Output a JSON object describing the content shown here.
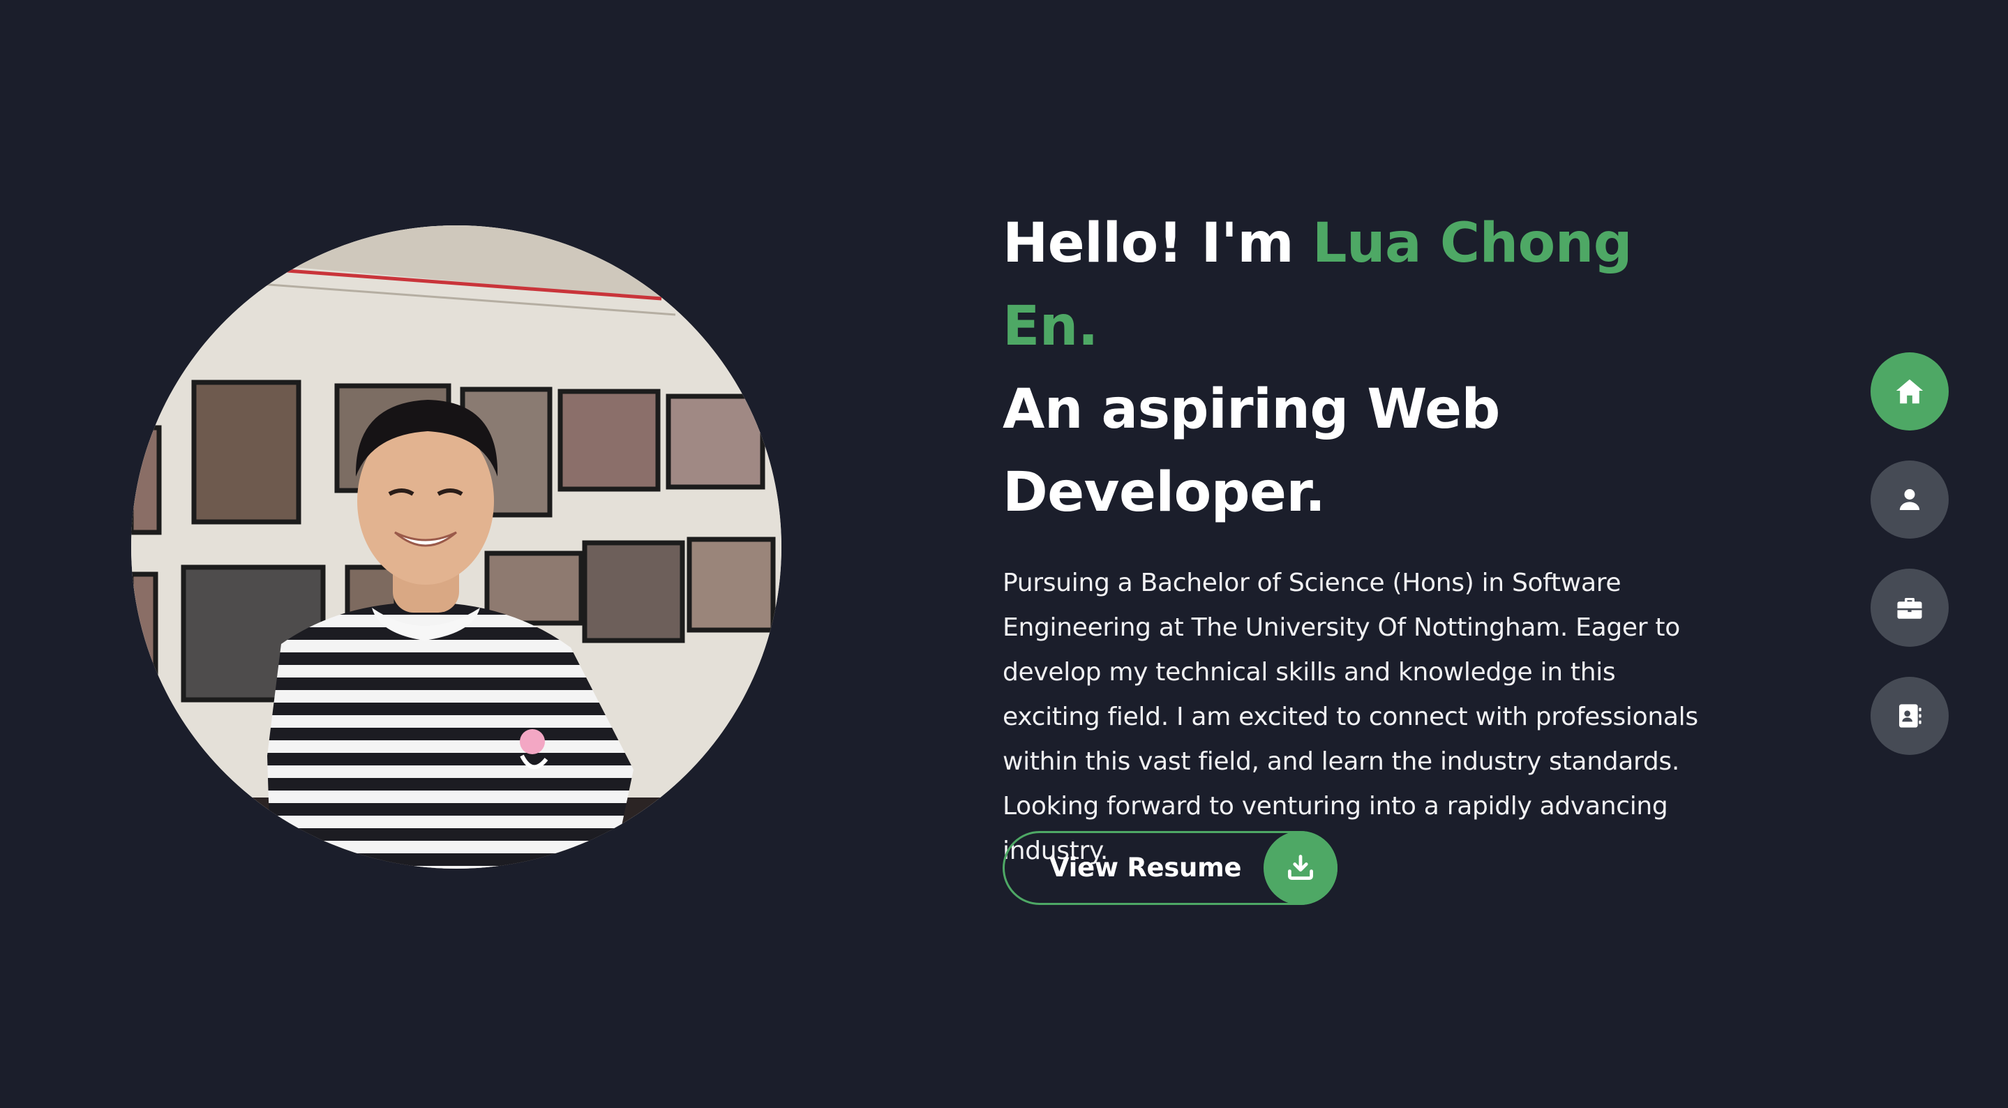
{
  "colors": {
    "background": "#1b1e2b",
    "accent": "#4ea865",
    "nav_inactive": "#464b55",
    "text": "#ffffff"
  },
  "hero": {
    "greeting": "Hello! I'm",
    "name": "Lua Chong En.",
    "tagline_line1": "An aspiring Web",
    "tagline_line2": "Developer.",
    "bio": "Pursuing a Bachelor of Science (Hons) in Software Engineering at The University Of Nottingham. Eager to develop my technical skills and knowledge in this exciting field. I am excited to connect with professionals within this vast field, and learn the industry standards. Looking forward to venturing into a rapidly advancing industry."
  },
  "resume_button": {
    "label": "View Resume",
    "icon": "download-icon"
  },
  "side_nav": [
    {
      "id": "home",
      "icon": "home-icon",
      "active": true
    },
    {
      "id": "about",
      "icon": "user-icon",
      "active": false
    },
    {
      "id": "projects",
      "icon": "briefcase-icon",
      "active": false
    },
    {
      "id": "contact",
      "icon": "contact-card-icon",
      "active": false
    }
  ]
}
